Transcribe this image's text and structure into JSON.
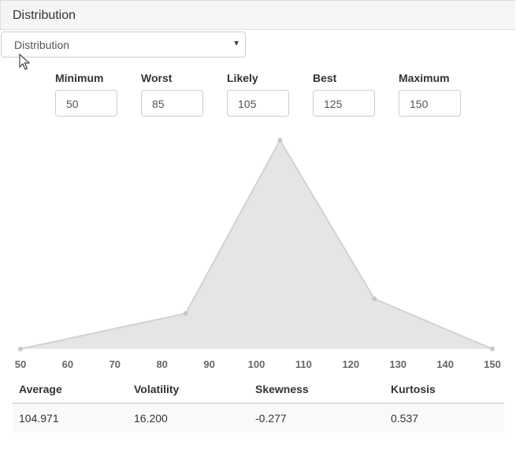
{
  "panel": {
    "title": "Distribution"
  },
  "select": {
    "value": "Distribution"
  },
  "fields": [
    {
      "label": "Minimum",
      "value": "50"
    },
    {
      "label": "Worst",
      "value": "85"
    },
    {
      "label": "Likely",
      "value": "105"
    },
    {
      "label": "Best",
      "value": "125"
    },
    {
      "label": "Maximum",
      "value": "150"
    }
  ],
  "chart_data": {
    "type": "area",
    "x": [
      50,
      85,
      105,
      125,
      150
    ],
    "y": [
      0,
      0.17,
      1.0,
      0.24,
      0
    ],
    "xlim": [
      50,
      150
    ],
    "ylim": [
      0,
      1
    ],
    "xticks": [
      "50",
      "60",
      "70",
      "80",
      "90",
      "100",
      "110",
      "120",
      "130",
      "140",
      "150"
    ],
    "grid": false,
    "fill_color": "#e5e5e5",
    "line_color": "#d2d2d2",
    "point_color": "#c8c8c8"
  },
  "stats": {
    "headers": [
      "Average",
      "Volatility",
      "Skewness",
      "Kurtosis"
    ],
    "values": [
      "104.971",
      "16.200",
      "-0.277",
      "0.537"
    ]
  }
}
